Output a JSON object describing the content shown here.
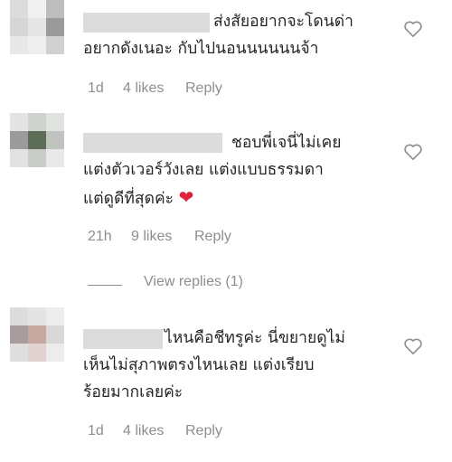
{
  "comments": [
    {
      "text_lines": [
        "ส่งสัยอยากจะโดนด่า",
        "อยากดังเนอะ กับไปนอนนนนนนจ้า"
      ],
      "time": "1d",
      "likes": "4 likes",
      "reply": "Reply",
      "avatar_colors": [
        "#dcdcdc",
        "#f0f0f0",
        "#bdbdbd",
        "#d6d6d6",
        "#e6e6e6",
        "#9a9a9a",
        "#e8e8e8",
        "#efefef",
        "#d0d0d0"
      ]
    },
    {
      "text_lines": [
        "ชอบพี่เจนี่ไม่เคย",
        "แต่งตัวเวอร์วังเลย แต่งแบบธรรมดา",
        "แต่ดูดีที่สุดค่ะ"
      ],
      "emoji": "❤",
      "time": "21h",
      "likes": "9 likes",
      "reply": "Reply",
      "avatar_colors": [
        "#e4e4e4",
        "#cfd3cf",
        "#dfe2df",
        "#9b9b9b",
        "#5c6e58",
        "#bfc4bf",
        "#e2e2e2",
        "#c9ccc9",
        "#e9e9e9"
      ]
    },
    {
      "text_lines": [
        "ไหนคือชีทรูค่ะ นี่ขยายดูไม่",
        "เห็นไม่สุภาพตรงไหนเลย แต่งเรียบ",
        "ร้อยมากเลยค่ะ"
      ],
      "time": "1d",
      "likes": "4 likes",
      "reply": "Reply",
      "avatar_colors": [
        "#dcdcdc",
        "#e4e4e4",
        "#ededed",
        "#a89c9c",
        "#c7a8a0",
        "#d8d8d8",
        "#dedede",
        "#e2d2d0",
        "#ececec"
      ]
    }
  ],
  "view_replies": "View replies (1)",
  "icons": {
    "like": "heart-outline-icon",
    "emoji": "red-heart-emoji"
  },
  "colors": {
    "text": "#262626",
    "meta": "#8e8e8e",
    "emoji_heart": "#e0213a"
  }
}
